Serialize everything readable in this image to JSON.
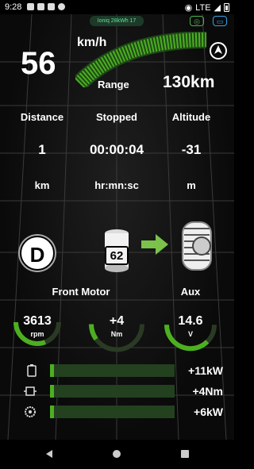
{
  "status_bar": {
    "time": "9:28",
    "network": "LTE"
  },
  "header": {
    "chip_text": "Ioniq 28kWh 17"
  },
  "speed": {
    "value": "56",
    "unit": "km/h"
  },
  "range": {
    "label": "Range",
    "value": "130km"
  },
  "trip": {
    "columns": [
      {
        "label": "Distance",
        "value": "1",
        "unit": "km"
      },
      {
        "label": "Stopped",
        "value": "00:00:04",
        "unit": "hr:mn:sc"
      },
      {
        "label": "Altitude",
        "value": "-31",
        "unit": "m"
      }
    ]
  },
  "drive": {
    "gear": "D",
    "battery_pct": "62"
  },
  "motors": {
    "front_label": "Front Motor",
    "aux_label": "Aux",
    "gauges": [
      {
        "value": "3613",
        "unit": "rpm",
        "level": 0.62
      },
      {
        "value": "+4",
        "unit": "Nm",
        "level": 0.2
      },
      {
        "value": "14.6",
        "unit": "V",
        "level": 0.75
      }
    ]
  },
  "power_bars": [
    {
      "icon": "battery-icon",
      "value": "+11kW",
      "level": 0.03
    },
    {
      "icon": "motor-icon",
      "value": "+4Nm",
      "level": 0.03
    },
    {
      "icon": "gear-cog-icon",
      "value": "+6kW",
      "level": 0.03
    }
  ],
  "colors": {
    "accent": "#4caf20",
    "bar_track": "#23401f",
    "chip_bg": "#1d3a28",
    "chip_text": "#5fe39a"
  }
}
